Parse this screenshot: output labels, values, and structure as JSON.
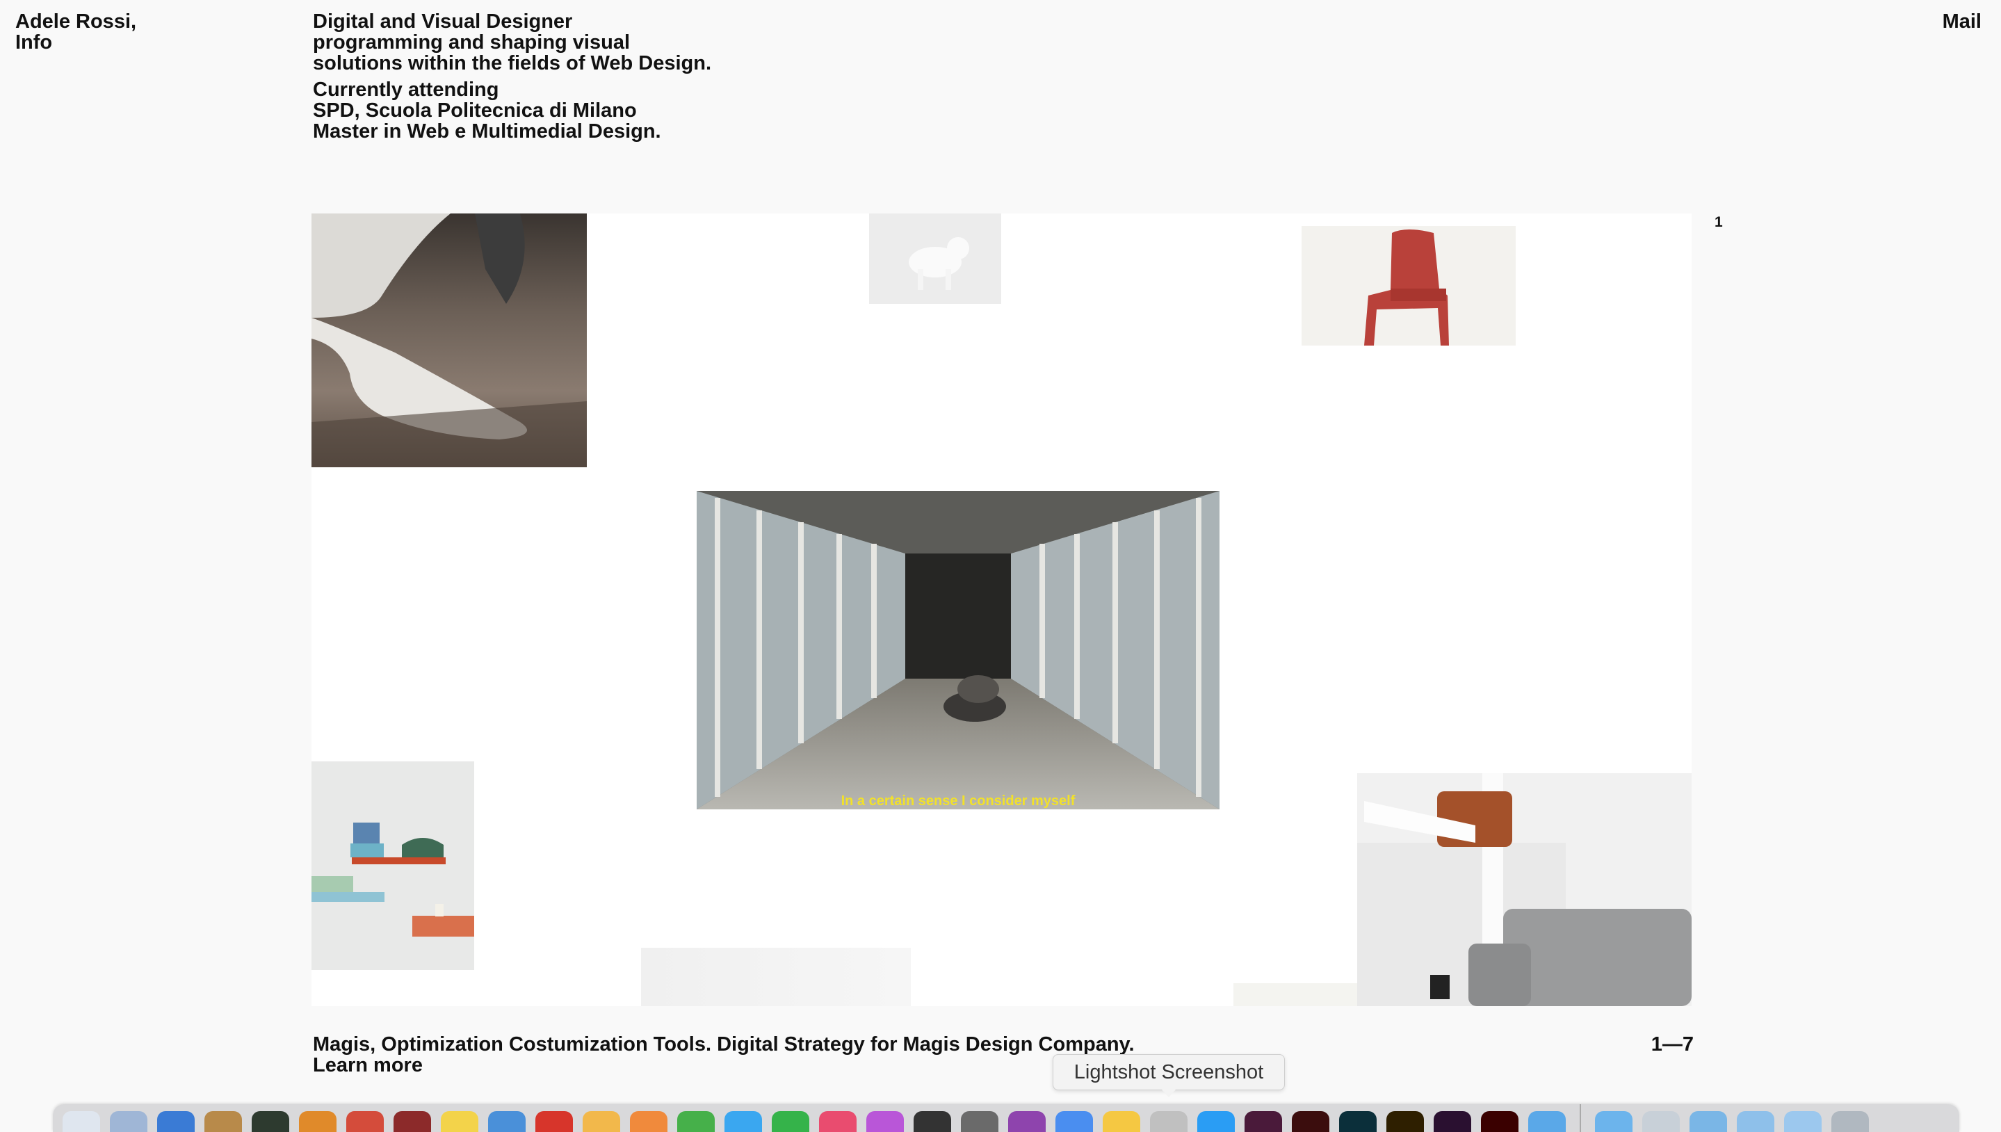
{
  "header": {
    "owner_name": "Adele Rossi,",
    "info_link": "Info",
    "mail_link": "Mail",
    "intro_lines": [
      "Digital and Visual Designer",
      "programming and shaping visual",
      "solutions within the fields of Web Design."
    ],
    "education_lines": [
      "Currently attending",
      "SPD, Scuola Politecnica di Milano",
      "Master in Web e Multimedial Design."
    ]
  },
  "gallery": {
    "slide_number": "1",
    "video_subtitle": "In a certain sense I consider myself"
  },
  "footer": {
    "project_caption": "Magis, Optimization Costumization Tools. Digital Strategy for Magis Design Company.",
    "learn_more": "Learn more",
    "page_counter": "1—7"
  },
  "dock": {
    "tooltip": "Lightshot Screenshot",
    "colors": [
      "#dfe6ef",
      "#9fb6d6",
      "#3a7bd5",
      "#b88a4a",
      "#2d3a2f",
      "#e08a2a",
      "#d44c3b",
      "#8c2a2a",
      "#f3d34a",
      "#4a90d9",
      "#d7352b",
      "#f2b84b",
      "#f08a3c",
      "#46b04a",
      "#3aa7f0",
      "#35b34a",
      "#e94c6f",
      "#b956d8",
      "#333333",
      "#6a6a6a",
      "#8e44ad",
      "#4a8ef0",
      "#f5c842",
      "#c0c0c0",
      "#2a9df4",
      "#4a1a3a",
      "#3b0d0d",
      "#0b2f3a",
      "#2e1f00",
      "#2a1030",
      "#3a0000",
      "#5aa8e8",
      "#6cb4ec",
      "#c8d0d8",
      "#7ab6e6",
      "#8ec0ea",
      "#9cc8ee",
      "#b0b8c0"
    ]
  }
}
